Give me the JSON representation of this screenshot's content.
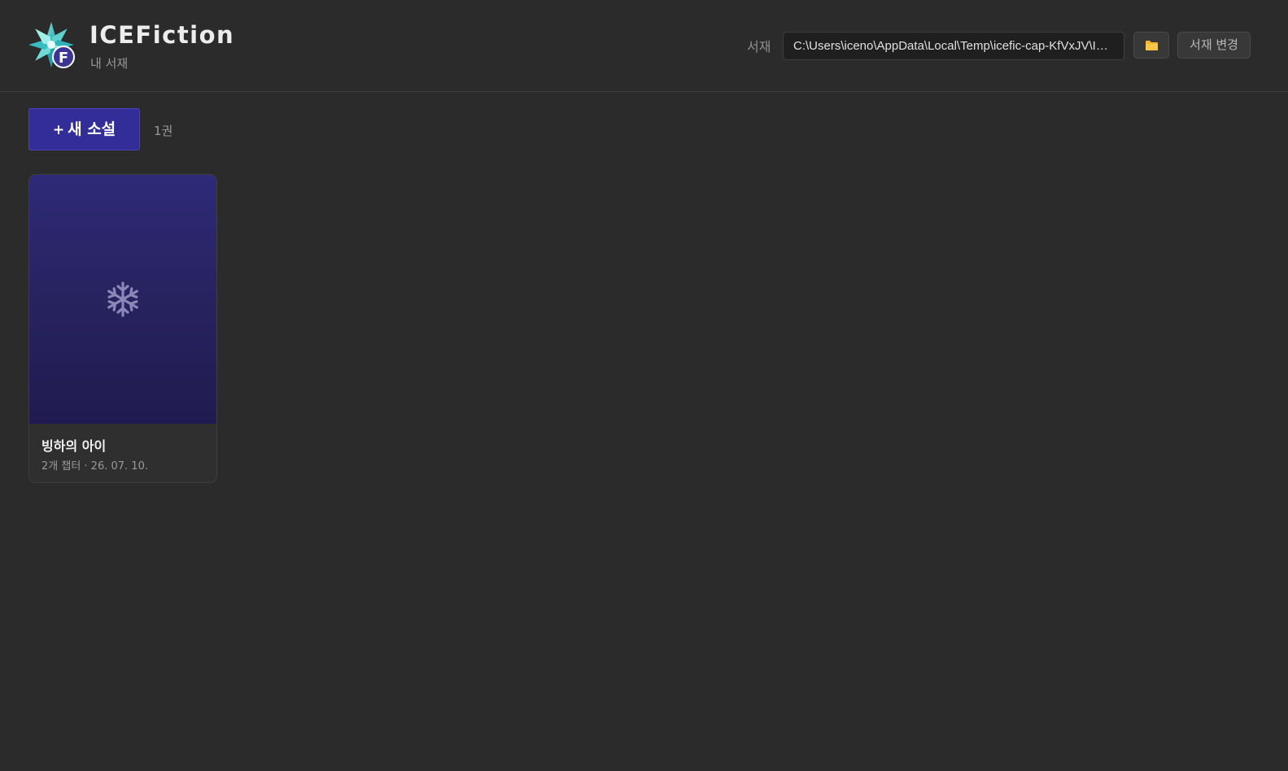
{
  "header": {
    "app_title": "ICEFiction",
    "subtitle": "내 서재",
    "library_label": "서재",
    "library_path": "C:\\Users\\iceno\\AppData\\Local\\Temp\\icefic-cap-KfVxJV\\ICE...",
    "folder_icon": "folder-icon",
    "change_library_label": "서재 변경"
  },
  "toolbar": {
    "new_novel_plus": "+",
    "new_novel_label": "새 소설",
    "book_count": "1권"
  },
  "books": [
    {
      "title": "빙하의 아이",
      "meta": "2개 챕터 · 26. 07. 10.",
      "cover_icon": "snowflake-icon"
    }
  ],
  "colors": {
    "background": "#2b2b2b",
    "accent": "#332d9a",
    "cover_top": "#2f2a78",
    "cover_bottom": "#201b4f",
    "folder": "#f2b632"
  }
}
